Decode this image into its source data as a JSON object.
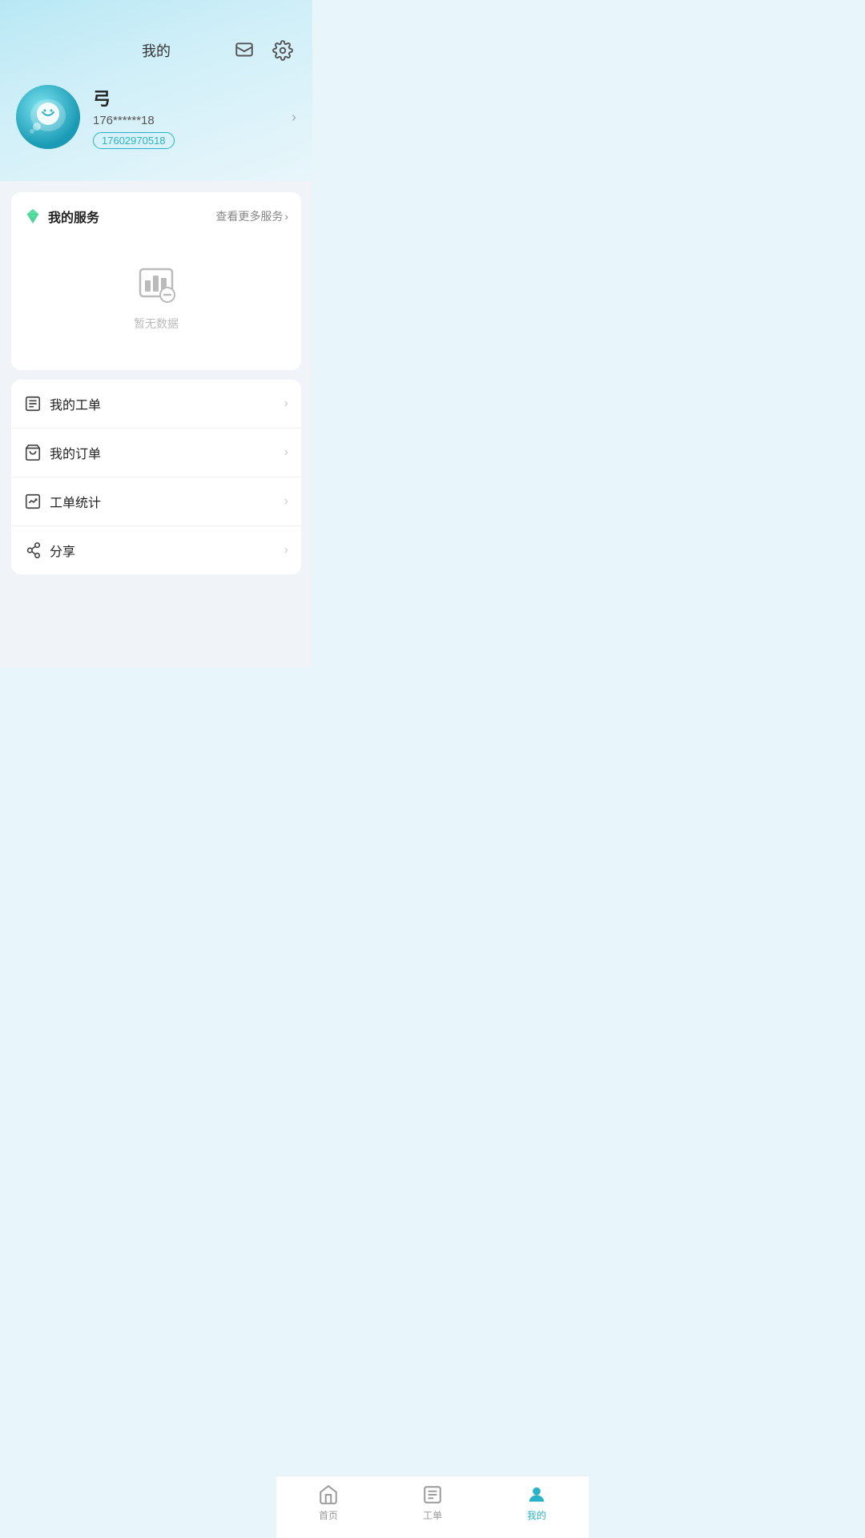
{
  "header": {
    "title": "我的",
    "message_icon": "message-icon",
    "settings_icon": "settings-icon"
  },
  "profile": {
    "name": "弓",
    "phone_masked": "176******18",
    "phone_full": "17602970518"
  },
  "my_service": {
    "title": "我的服务",
    "more_label": "查看更多服务",
    "empty_text": "暂无数据"
  },
  "menu_items": [
    {
      "id": "work-order",
      "icon": "work-order-icon",
      "label": "我的工单"
    },
    {
      "id": "order",
      "icon": "order-icon",
      "label": "我的订单"
    },
    {
      "id": "statistics",
      "icon": "statistics-icon",
      "label": "工单统计"
    },
    {
      "id": "share",
      "icon": "share-icon",
      "label": "分享"
    }
  ],
  "bottom_nav": [
    {
      "id": "home",
      "label": "首页",
      "active": false
    },
    {
      "id": "workorder",
      "label": "工单",
      "active": false
    },
    {
      "id": "mine",
      "label": "我的",
      "active": true
    }
  ]
}
